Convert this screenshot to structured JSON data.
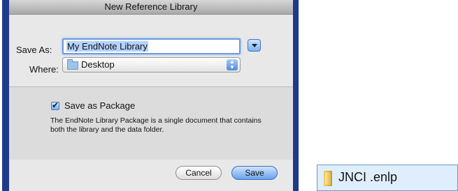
{
  "dialog": {
    "title": "New Reference Library",
    "save_as_label": "Save As:",
    "save_as_value": "My EndNote Library",
    "where_label": "Where:",
    "where_value": "Desktop",
    "package_checkbox_label": "Save as Package",
    "package_checkbox_checked": true,
    "package_description": "The EndNote Library Package is a single document that contains both the library and the data folder.",
    "cancel_label": "Cancel",
    "save_label": "Save"
  },
  "file_item": {
    "name": "JNCI .enlp",
    "icon": "package-folder-icon"
  },
  "colors": {
    "dialog_frame": "#1f3a8a",
    "accent_blue": "#69a1e8"
  }
}
